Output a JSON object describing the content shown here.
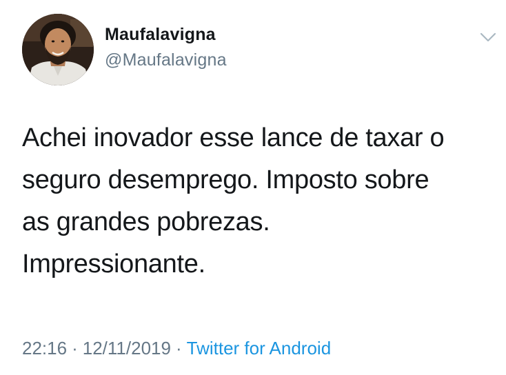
{
  "user": {
    "display_name": "Maufalavigna",
    "handle": "@Maufalavigna"
  },
  "tweet": {
    "lines": [
      "Achei inovador esse lance de taxar o",
      "seguro desemprego. Imposto sobre",
      "as grandes pobrezas.",
      "Impressionante."
    ]
  },
  "meta": {
    "time": "22:16",
    "separator": "·",
    "date": "12/11/2019",
    "source": "Twitter for Android"
  },
  "icons": {
    "more_menu": "chevron-down-icon"
  },
  "colors": {
    "link": "#1b95e0",
    "secondary_text": "#657786",
    "primary_text": "#14171a"
  }
}
